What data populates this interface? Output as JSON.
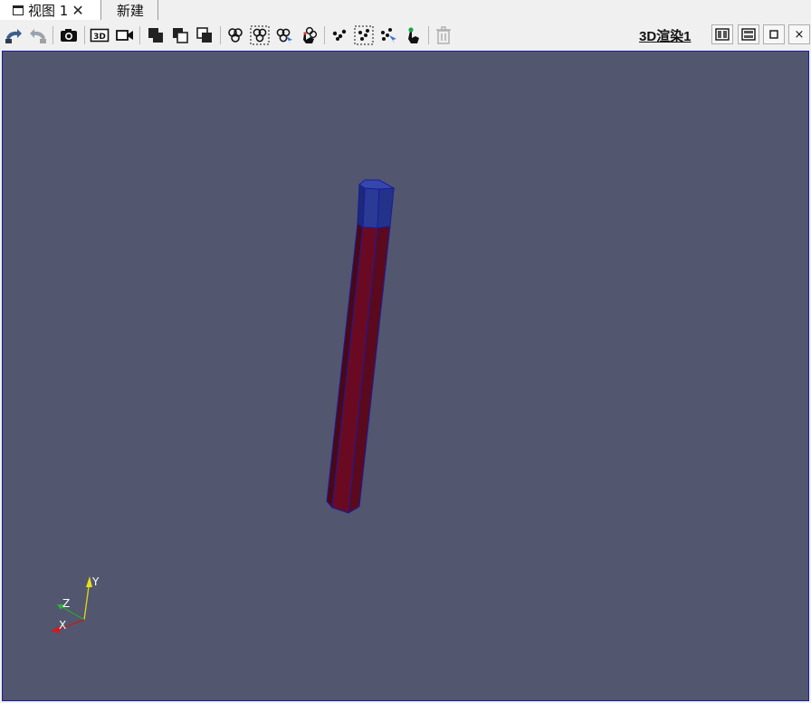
{
  "tabs": [
    {
      "label": "视图 1",
      "close": "✕"
    },
    {
      "label": "新建"
    }
  ],
  "toolbar": {
    "icons": [
      "undo-camera-icon",
      "redo-camera-icon",
      "screenshot-camera-icon",
      "3d-icon",
      "video-camera-icon",
      "show-selected-icon",
      "hide-selected-icon",
      "isolate-selected-icon",
      "select-cells-icon",
      "select-cells-box-icon",
      "select-cells-polygon-icon",
      "interactive-select-cells-icon",
      "select-points-icon",
      "select-points-box-icon",
      "select-points-polygon-icon",
      "interactive-select-points-icon",
      "clear-selection-icon"
    ],
    "three_d_label": "3D"
  },
  "view": {
    "title": "3D渲染1",
    "buttons": {
      "close": "×"
    }
  },
  "scene": {
    "background": "#52566f",
    "body_color": "#6a0a22",
    "cap_color": "#2b3a95",
    "edge_color": "#1a1a9e"
  },
  "axes": {
    "x": "X",
    "y": "Y",
    "z": "Z"
  }
}
